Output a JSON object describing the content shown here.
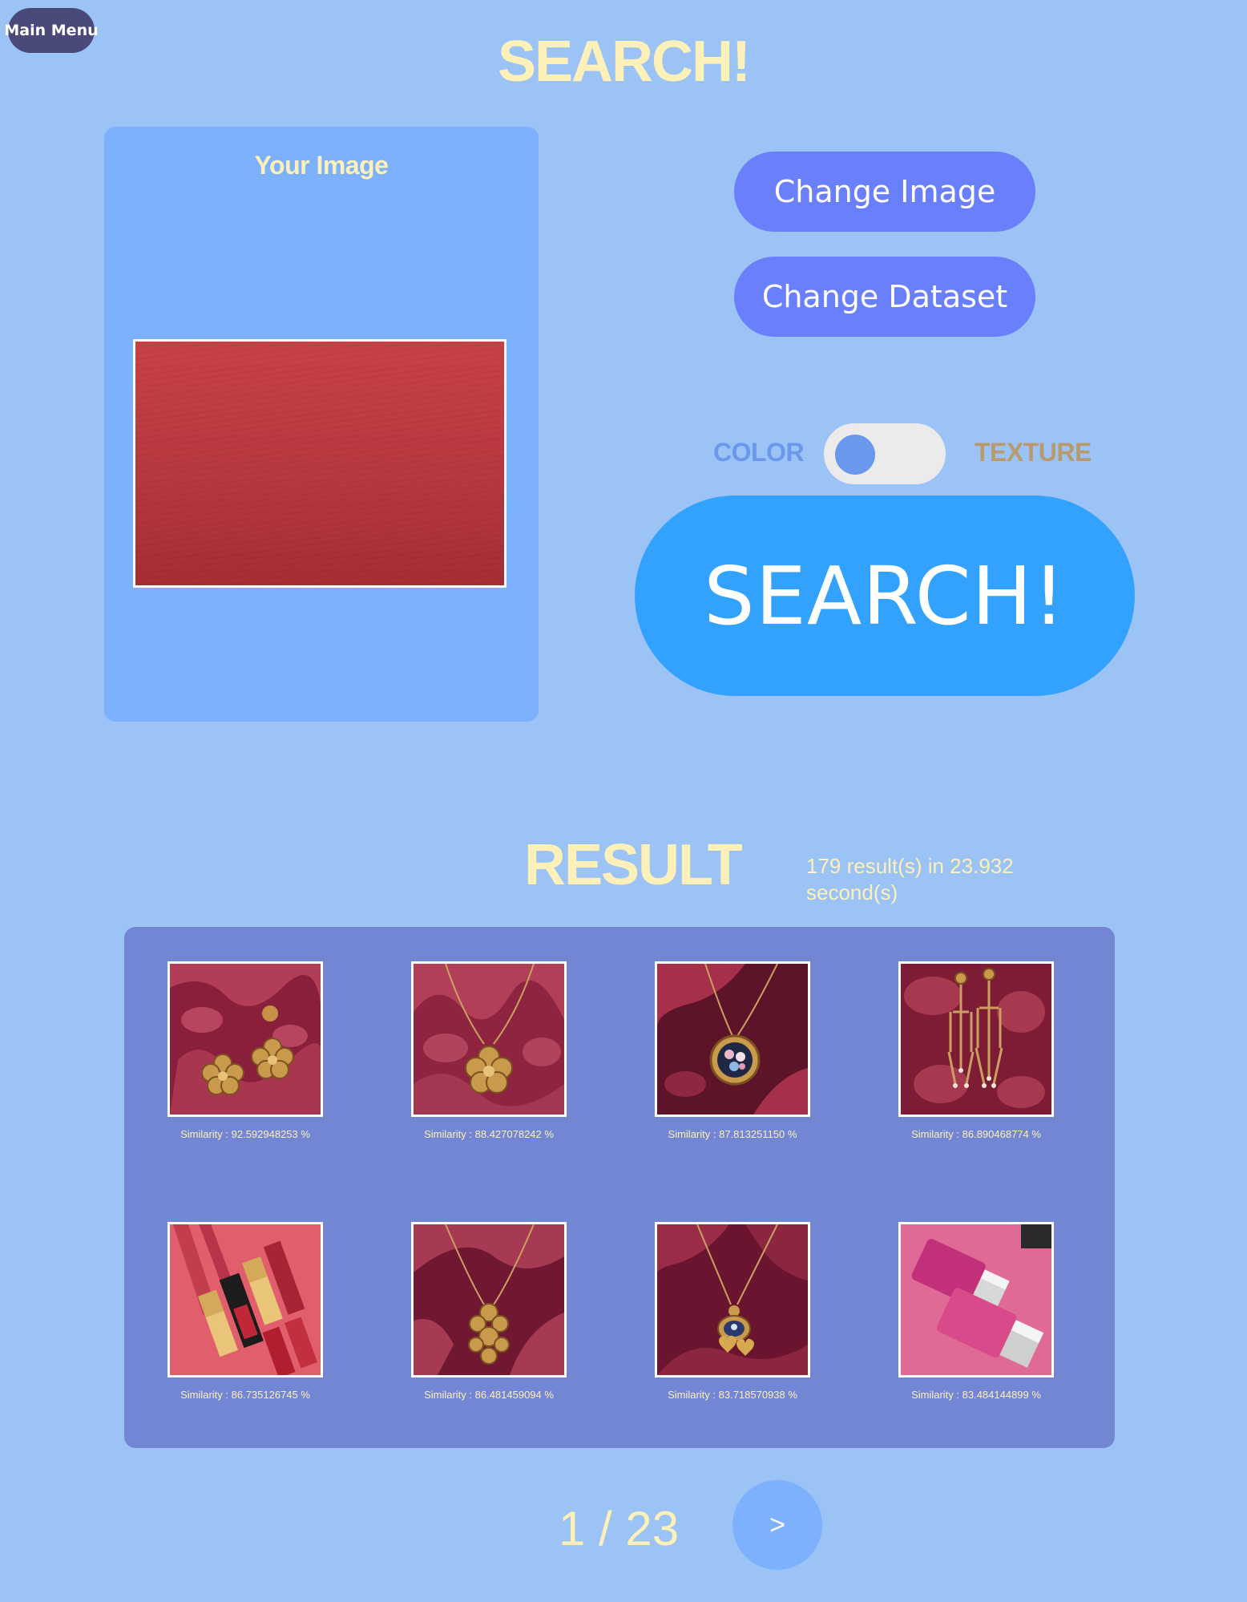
{
  "nav": {
    "main_menu_label": "Main Menu"
  },
  "page_title": "SEARCH!",
  "query_panel": {
    "title": "Your Image"
  },
  "actions": {
    "change_image_label": "Change Image",
    "change_dataset_label": "Change Dataset",
    "search_label": "SEARCH!"
  },
  "mode_toggle": {
    "left_label": "COLOR",
    "right_label": "TEXTURE",
    "selected": "COLOR",
    "colors": {
      "color_label": "#6a98ec",
      "texture_label": "#b89a6e",
      "knob": "#6a98ec"
    }
  },
  "results": {
    "title": "RESULT",
    "stats": "179 result(s) in 23.932 second(s)",
    "items": [
      {
        "similarity": "Similarity : 92.592948253 %",
        "thumb": "earrings-on-damask"
      },
      {
        "similarity": "Similarity : 88.427078242 %",
        "thumb": "flower-pendant-on-damask"
      },
      {
        "similarity": "Similarity : 87.813251150 %",
        "thumb": "floral-cameo-pendant"
      },
      {
        "similarity": "Similarity : 86.890468774 %",
        "thumb": "chandelier-earrings"
      },
      {
        "similarity": "Similarity : 86.735126745 %",
        "thumb": "lipsticks-on-pink"
      },
      {
        "similarity": "Similarity : 86.481459094 %",
        "thumb": "filigree-pendant"
      },
      {
        "similarity": "Similarity : 83.718570938 %",
        "thumb": "heart-pendant-necklace"
      },
      {
        "similarity": "Similarity : 83.484144899 %",
        "thumb": "nail-polish-bottles"
      }
    ]
  },
  "pagination": {
    "label": "1 / 23",
    "next_label": ">"
  },
  "colors": {
    "background": "#9bc3f5",
    "title_text": "#fdf0b8",
    "panel": "#7db0fd",
    "results_panel": "#7386d3",
    "button": "#6a7ffb",
    "search_button": "#33a2ff",
    "main_menu_button": "#4a4a7a"
  }
}
